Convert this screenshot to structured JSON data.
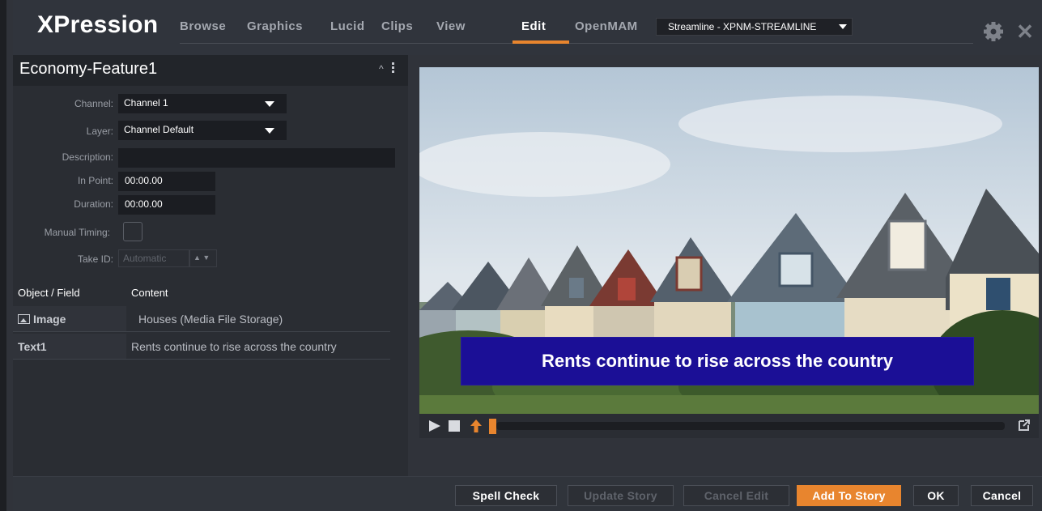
{
  "app": {
    "title": "XPression"
  },
  "tabs": [
    {
      "label": "Browse",
      "active": false
    },
    {
      "label": "Graphics",
      "active": false
    },
    {
      "label": "Lucid",
      "active": false
    },
    {
      "label": "Clips",
      "active": false
    },
    {
      "label": "View",
      "active": false
    },
    {
      "label": "Edit",
      "active": true
    },
    {
      "label": "OpenMAM",
      "active": false
    }
  ],
  "server_select": {
    "value": "Streamline - XPNM-STREAMLINE"
  },
  "header_icons": [
    "gear-icon",
    "close-icon"
  ],
  "panel": {
    "title": "Economy-Feature1",
    "fields": {
      "channel": {
        "label": "Channel:",
        "value": "Channel 1"
      },
      "layer": {
        "label": "Layer:",
        "value": "Channel Default"
      },
      "description": {
        "label": "Description:",
        "value": ""
      },
      "in_point": {
        "label": "In Point:",
        "value": "00:00.00"
      },
      "duration": {
        "label": "Duration:",
        "value": "00:00.00"
      },
      "manual_timing": {
        "label": "Manual Timing:",
        "checked": false
      },
      "take_id": {
        "label": "Take ID:",
        "placeholder": "Automatic"
      }
    },
    "table": {
      "headers": [
        "Object / Field",
        "Content"
      ],
      "rows": [
        {
          "object": "Image",
          "icon": "image-icon",
          "content": "Houses (Media File Storage)"
        },
        {
          "object": "Text1",
          "content": "Rents continue to rise across the country"
        }
      ]
    }
  },
  "preview": {
    "lower_third": "Rents continue to rise across the country",
    "controls": [
      "play-icon",
      "stop-icon",
      "up-arrow-icon",
      "popout-icon"
    ],
    "accent": "#e8852e",
    "lower_third_color": "#1b0f96"
  },
  "buttons": {
    "spell_check": "Spell Check",
    "update_story": "Update Story",
    "cancel_edit": "Cancel Edit",
    "add_to_story": "Add To Story",
    "ok": "OK",
    "cancel": "Cancel"
  }
}
